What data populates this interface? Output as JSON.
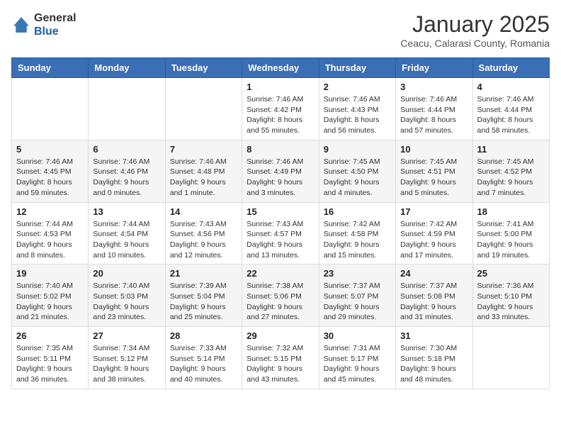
{
  "header": {
    "logo_general": "General",
    "logo_blue": "Blue",
    "month_title": "January 2025",
    "location": "Ceacu, Calarasi County, Romania"
  },
  "days_of_week": [
    "Sunday",
    "Monday",
    "Tuesday",
    "Wednesday",
    "Thursday",
    "Friday",
    "Saturday"
  ],
  "weeks": [
    [
      {
        "day": "",
        "info": ""
      },
      {
        "day": "",
        "info": ""
      },
      {
        "day": "",
        "info": ""
      },
      {
        "day": "1",
        "info": "Sunrise: 7:46 AM\nSunset: 4:42 PM\nDaylight: 8 hours\nand 55 minutes."
      },
      {
        "day": "2",
        "info": "Sunrise: 7:46 AM\nSunset: 4:43 PM\nDaylight: 8 hours\nand 56 minutes."
      },
      {
        "day": "3",
        "info": "Sunrise: 7:46 AM\nSunset: 4:44 PM\nDaylight: 8 hours\nand 57 minutes."
      },
      {
        "day": "4",
        "info": "Sunrise: 7:46 AM\nSunset: 4:44 PM\nDaylight: 8 hours\nand 58 minutes."
      }
    ],
    [
      {
        "day": "5",
        "info": "Sunrise: 7:46 AM\nSunset: 4:45 PM\nDaylight: 8 hours\nand 59 minutes."
      },
      {
        "day": "6",
        "info": "Sunrise: 7:46 AM\nSunset: 4:46 PM\nDaylight: 9 hours\nand 0 minutes."
      },
      {
        "day": "7",
        "info": "Sunrise: 7:46 AM\nSunset: 4:48 PM\nDaylight: 9 hours\nand 1 minute."
      },
      {
        "day": "8",
        "info": "Sunrise: 7:46 AM\nSunset: 4:49 PM\nDaylight: 9 hours\nand 3 minutes."
      },
      {
        "day": "9",
        "info": "Sunrise: 7:45 AM\nSunset: 4:50 PM\nDaylight: 9 hours\nand 4 minutes."
      },
      {
        "day": "10",
        "info": "Sunrise: 7:45 AM\nSunset: 4:51 PM\nDaylight: 9 hours\nand 5 minutes."
      },
      {
        "day": "11",
        "info": "Sunrise: 7:45 AM\nSunset: 4:52 PM\nDaylight: 9 hours\nand 7 minutes."
      }
    ],
    [
      {
        "day": "12",
        "info": "Sunrise: 7:44 AM\nSunset: 4:53 PM\nDaylight: 9 hours\nand 8 minutes."
      },
      {
        "day": "13",
        "info": "Sunrise: 7:44 AM\nSunset: 4:54 PM\nDaylight: 9 hours\nand 10 minutes."
      },
      {
        "day": "14",
        "info": "Sunrise: 7:43 AM\nSunset: 4:56 PM\nDaylight: 9 hours\nand 12 minutes."
      },
      {
        "day": "15",
        "info": "Sunrise: 7:43 AM\nSunset: 4:57 PM\nDaylight: 9 hours\nand 13 minutes."
      },
      {
        "day": "16",
        "info": "Sunrise: 7:42 AM\nSunset: 4:58 PM\nDaylight: 9 hours\nand 15 minutes."
      },
      {
        "day": "17",
        "info": "Sunrise: 7:42 AM\nSunset: 4:59 PM\nDaylight: 9 hours\nand 17 minutes."
      },
      {
        "day": "18",
        "info": "Sunrise: 7:41 AM\nSunset: 5:00 PM\nDaylight: 9 hours\nand 19 minutes."
      }
    ],
    [
      {
        "day": "19",
        "info": "Sunrise: 7:40 AM\nSunset: 5:02 PM\nDaylight: 9 hours\nand 21 minutes."
      },
      {
        "day": "20",
        "info": "Sunrise: 7:40 AM\nSunset: 5:03 PM\nDaylight: 9 hours\nand 23 minutes."
      },
      {
        "day": "21",
        "info": "Sunrise: 7:39 AM\nSunset: 5:04 PM\nDaylight: 9 hours\nand 25 minutes."
      },
      {
        "day": "22",
        "info": "Sunrise: 7:38 AM\nSunset: 5:06 PM\nDaylight: 9 hours\nand 27 minutes."
      },
      {
        "day": "23",
        "info": "Sunrise: 7:37 AM\nSunset: 5:07 PM\nDaylight: 9 hours\nand 29 minutes."
      },
      {
        "day": "24",
        "info": "Sunrise: 7:37 AM\nSunset: 5:08 PM\nDaylight: 9 hours\nand 31 minutes."
      },
      {
        "day": "25",
        "info": "Sunrise: 7:36 AM\nSunset: 5:10 PM\nDaylight: 9 hours\nand 33 minutes."
      }
    ],
    [
      {
        "day": "26",
        "info": "Sunrise: 7:35 AM\nSunset: 5:11 PM\nDaylight: 9 hours\nand 36 minutes."
      },
      {
        "day": "27",
        "info": "Sunrise: 7:34 AM\nSunset: 5:12 PM\nDaylight: 9 hours\nand 38 minutes."
      },
      {
        "day": "28",
        "info": "Sunrise: 7:33 AM\nSunset: 5:14 PM\nDaylight: 9 hours\nand 40 minutes."
      },
      {
        "day": "29",
        "info": "Sunrise: 7:32 AM\nSunset: 5:15 PM\nDaylight: 9 hours\nand 43 minutes."
      },
      {
        "day": "30",
        "info": "Sunrise: 7:31 AM\nSunset: 5:17 PM\nDaylight: 9 hours\nand 45 minutes."
      },
      {
        "day": "31",
        "info": "Sunrise: 7:30 AM\nSunset: 5:18 PM\nDaylight: 9 hours\nand 48 minutes."
      },
      {
        "day": "",
        "info": ""
      }
    ]
  ]
}
